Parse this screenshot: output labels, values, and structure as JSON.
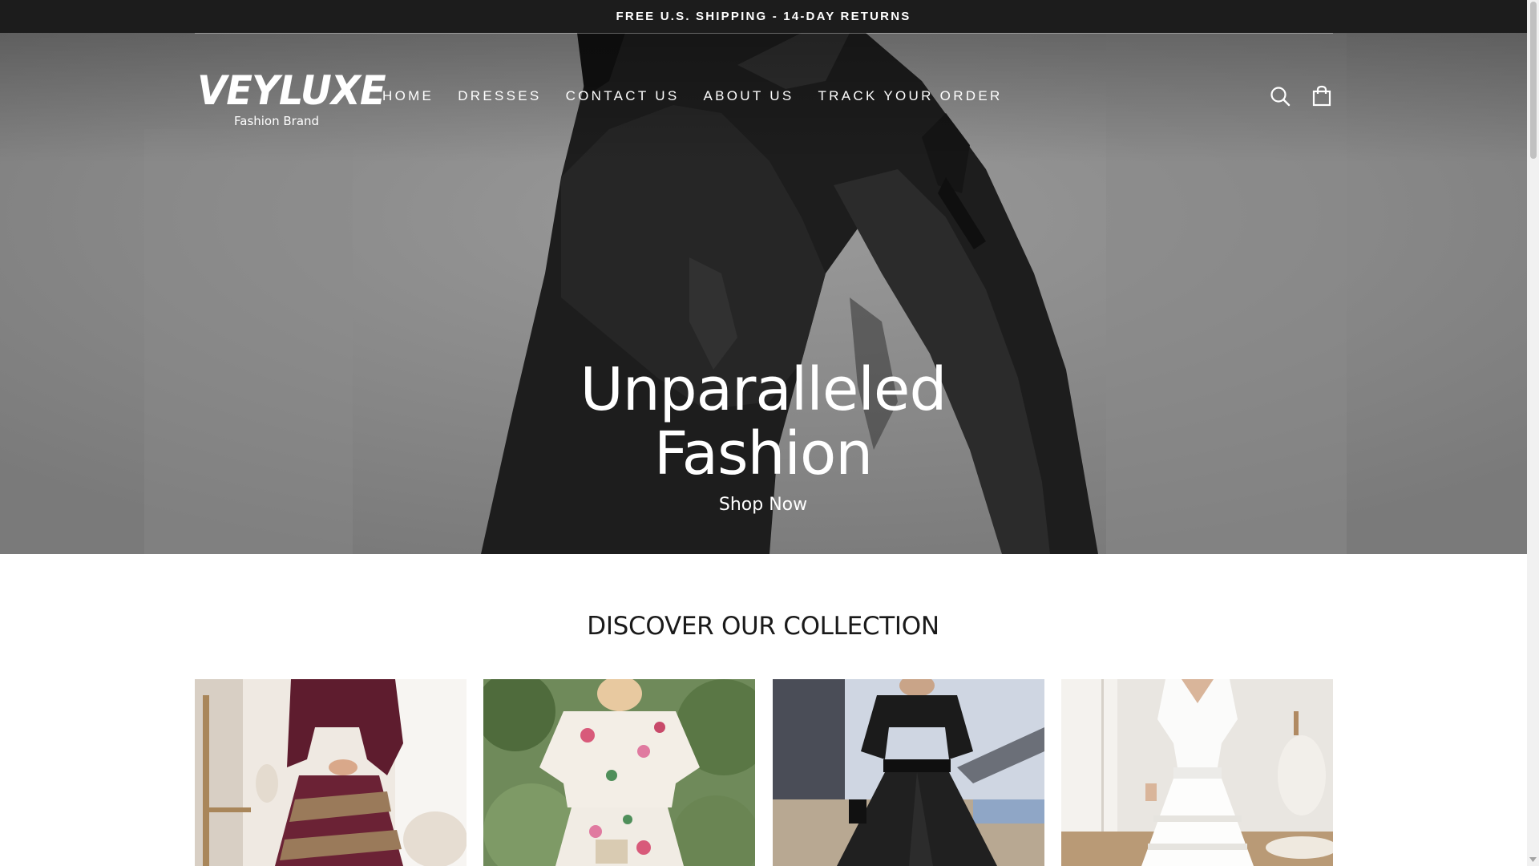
{
  "announcement": {
    "text": "FREE U.S. SHIPPING - 14-DAY RETURNS"
  },
  "header": {
    "logo_main": "VEYLUXE",
    "logo_sub": "Fashion Brand",
    "nav": [
      {
        "label": "HOME"
      },
      {
        "label": "DRESSES"
      },
      {
        "label": "CONTACT US"
      },
      {
        "label": "ABOUT US"
      },
      {
        "label": "TRACK YOUR ORDER"
      }
    ],
    "icons": [
      "search-icon",
      "shopping-bag-icon"
    ]
  },
  "hero": {
    "title": "Unparalleled Fashion",
    "cta": "Shop Now"
  },
  "collection": {
    "title": "DISCOVER OUR COLLECTION",
    "items": [
      {
        "image": "burgundy-striped-dress"
      },
      {
        "image": "floral-print-set"
      },
      {
        "image": "black-belted-dress"
      },
      {
        "image": "white-lace-dress"
      }
    ]
  },
  "colors": {
    "announcement_bg": "#1c1c1c",
    "text_dark": "#1a1a1a",
    "white": "#ffffff"
  }
}
